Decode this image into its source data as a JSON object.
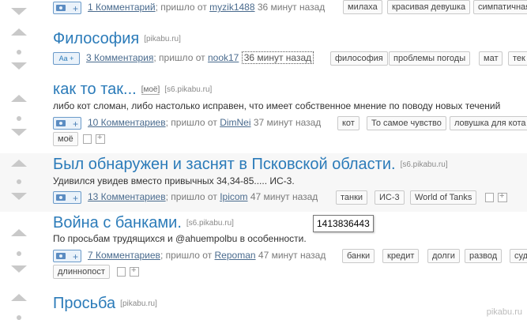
{
  "posts": [
    {
      "id": "p0",
      "meta": {
        "comments": "1 Комментарий",
        "sep": "; пришло от",
        "author": "myzik1488",
        "time": "36 минут назад"
      },
      "tags": [
        "милаха",
        "красивая девушка",
        "симпатичная"
      ]
    },
    {
      "id": "p1",
      "title": "Философия",
      "source": "[pikabu.ru]",
      "icon_text": "Aa +",
      "meta": {
        "comments": "3 Комментария",
        "sep": "; пришло от",
        "author": "nook17",
        "time": "36 минут назад"
      },
      "tags": [
        "философия",
        "проблемы погоды",
        "мат",
        "тек"
      ]
    },
    {
      "id": "p2",
      "title": "как то так...",
      "mine": "[моё]",
      "source": "[s6.pikabu.ru]",
      "desc": "либо кот сломан, либо настолько исправен, что имеет собственное мнение по поводу новых течений",
      "meta": {
        "comments": "10 Комментариев",
        "sep": "; пришло от",
        "author": "DimNei",
        "time": "37 минут назад"
      },
      "tags": [
        "кот",
        "То самое чувство",
        "ловушка для кота",
        "моё"
      ]
    },
    {
      "id": "p3",
      "title": "Был обнаружен и заснят в Псковской области.",
      "source": "[s6.pikabu.ru]",
      "desc": "Удивился увидев вместо привычных 34,34-85..... ИС-3.",
      "meta": {
        "comments": "13 Комментариев",
        "sep": "; пришло от",
        "author": "Ipicom",
        "time": "47 минут назад"
      },
      "tags": [
        "танки",
        "ИС-3",
        "World of Tanks"
      ]
    },
    {
      "id": "p4",
      "title": "Война с банками.",
      "source": "[s6.pikabu.ru]",
      "desc": "По просьбам трудящихся и @ahuempolbu в особенности.",
      "meta": {
        "comments": "7 Комментариев",
        "sep": "; пришло от",
        "author": "Repoman",
        "time": "47 минут назад"
      },
      "tags": [
        "банки",
        "кредит",
        "долги",
        "развод",
        "суд",
        "длиннопост"
      ]
    },
    {
      "id": "p5",
      "title": "Просьба",
      "source": "[pikabu.ru]"
    }
  ],
  "tooltip": "1413836443",
  "watermark": "pikabu.ru"
}
